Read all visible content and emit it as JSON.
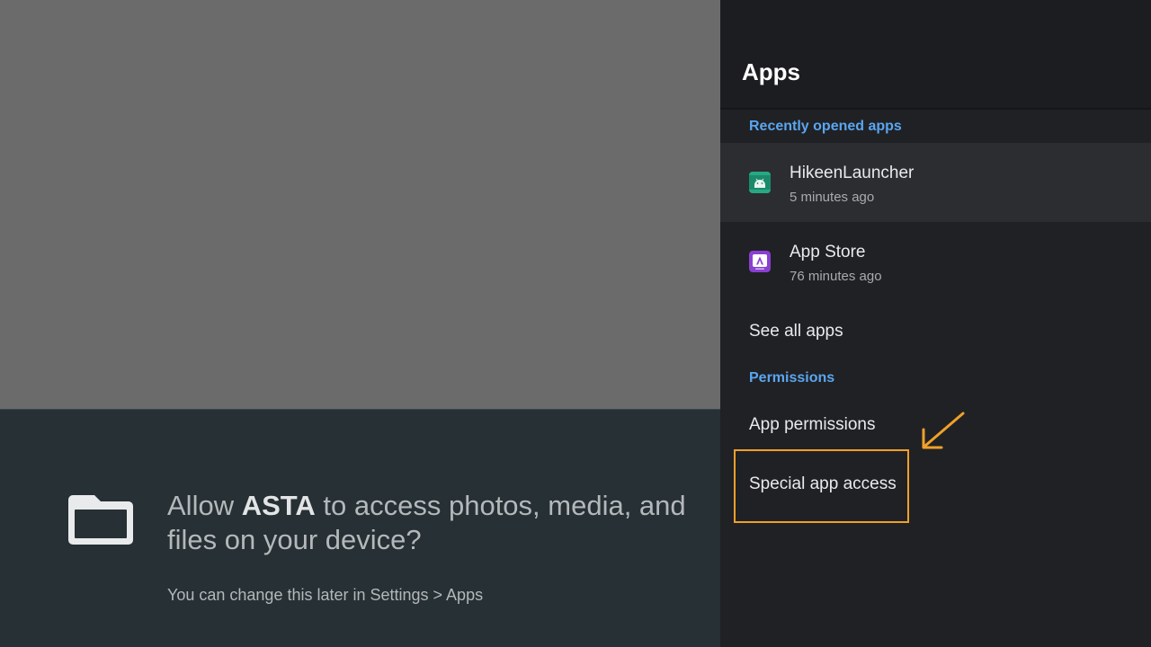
{
  "dialog": {
    "title_prefix": "Allow ",
    "app_name": "ASTA",
    "title_suffix": " to access photos, media, and files on your device?",
    "subtitle": "You can change this later in Settings > Apps",
    "icon": "folder-icon"
  },
  "panel": {
    "title": "Apps",
    "recent_header": "Recently opened apps",
    "recent_apps": [
      {
        "name": "HikeenLauncher",
        "time": "5 minutes ago",
        "icon": "android-icon",
        "color": "#1b8a6b"
      },
      {
        "name": "App Store",
        "time": "76 minutes ago",
        "icon": "app-store-icon",
        "color": "#8a3fd1"
      }
    ],
    "see_all": "See all apps",
    "permissions_header": "Permissions",
    "app_permissions": "App permissions",
    "special_access": "Special app access"
  },
  "colors": {
    "accent": "#5aa6f0",
    "highlight": "#f0a02a"
  }
}
